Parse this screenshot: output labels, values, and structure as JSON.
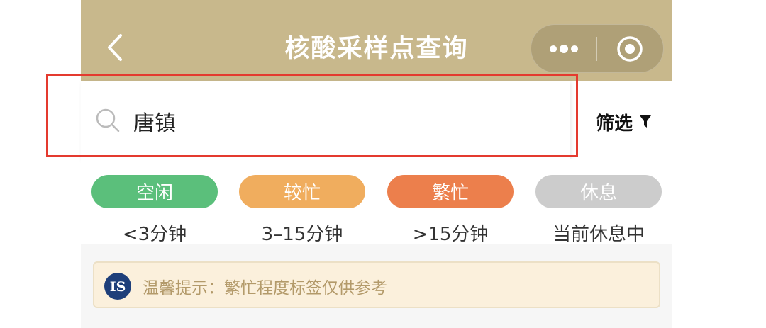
{
  "header": {
    "title": "核酸采样点查询",
    "back_icon": "chevron-left-icon",
    "more_icon": "more-dots-icon",
    "close_icon": "target-close-icon",
    "bg_color": "#c8b88c"
  },
  "search": {
    "value": "唐镇",
    "icon": "search-icon",
    "filter_label": "筛选",
    "filter_icon": "funnel-icon"
  },
  "legend": [
    {
      "status": "空闲",
      "desc": "<3分钟",
      "color": "#5bbf7b"
    },
    {
      "status": "较忙",
      "desc": "3–15分钟",
      "color": "#f0ad5e"
    },
    {
      "status": "繁忙",
      "desc": ">15分钟",
      "color": "#ec7f4c"
    },
    {
      "status": "休息",
      "desc": "当前休息中",
      "color": "#cccccc"
    }
  ],
  "tip": {
    "logo_text": "IS",
    "text": "温馨提示：繁忙程度标签仅供参考"
  }
}
